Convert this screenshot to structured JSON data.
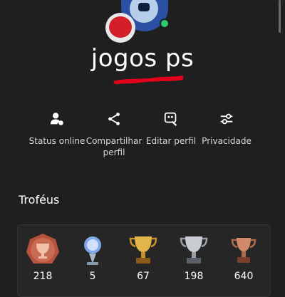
{
  "profile": {
    "username": "jogos ps",
    "avatar_icon": "avatar-icon",
    "online": true,
    "colors": {
      "background": "#1f1f1f",
      "online": "#2ecc71",
      "redaction": "#e3001b"
    }
  },
  "actions": [
    {
      "label": "Status online",
      "icon": "user-status-icon"
    },
    {
      "label": "Compartilhar perfil",
      "icon": "share-icon"
    },
    {
      "label": "Editar perfil",
      "icon": "edit-profile-icon"
    },
    {
      "label": "Privacidade",
      "icon": "privacy-sliders-icon"
    }
  ],
  "trophies": {
    "title": "Troféus",
    "items": [
      {
        "type": "level",
        "icon": "trophy-level-icon",
        "count": "218"
      },
      {
        "type": "platinum",
        "icon": "platinum-trophy-icon",
        "count": "5"
      },
      {
        "type": "gold",
        "icon": "gold-trophy-icon",
        "count": "67"
      },
      {
        "type": "silver",
        "icon": "silver-trophy-icon",
        "count": "198"
      },
      {
        "type": "bronze",
        "icon": "bronze-trophy-icon",
        "count": "640"
      }
    ]
  }
}
